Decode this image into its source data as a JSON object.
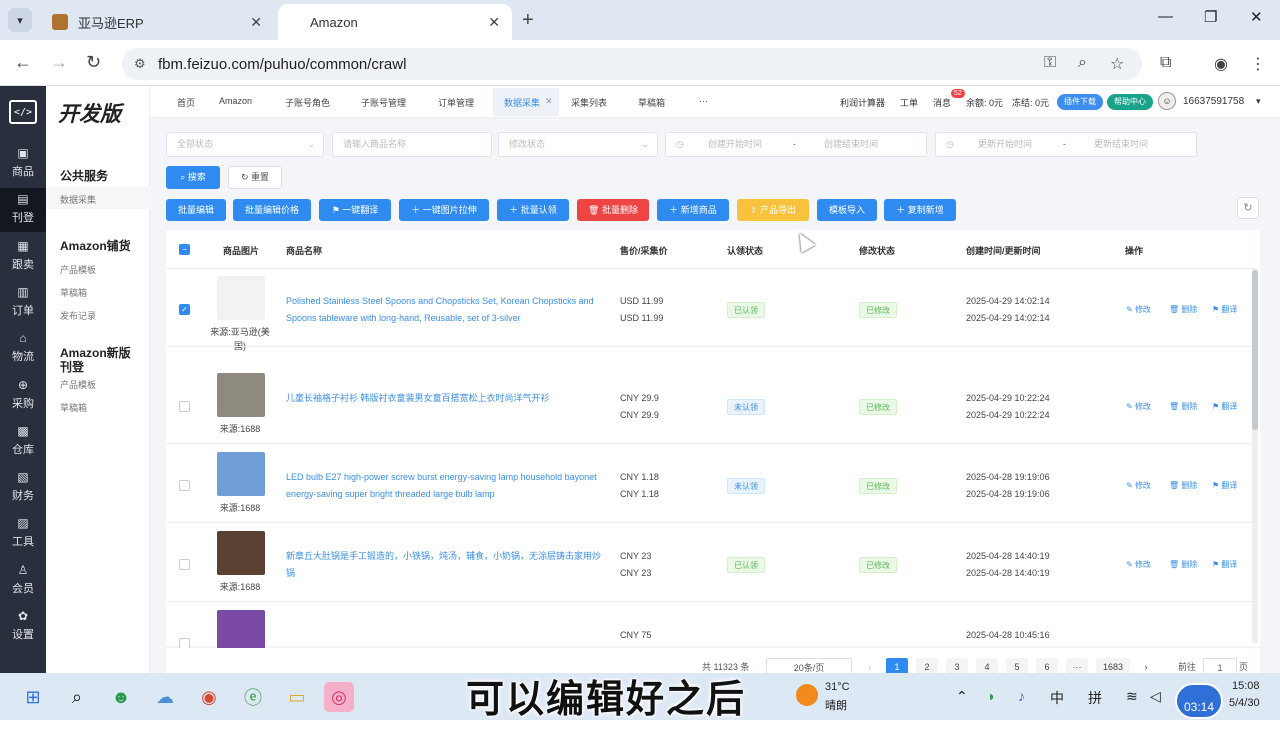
{
  "browser": {
    "tabs": [
      {
        "title": "亚马逊ERP",
        "favicon": "box-icon"
      },
      {
        "title": "Amazon",
        "favicon": ""
      }
    ],
    "new_tab_icon": "+",
    "window_controls": [
      "—",
      "❐",
      "✕"
    ],
    "url": "fbm.feizuo.com/puhuo/common/crawl"
  },
  "app": {
    "brand": "开发版",
    "left_nav": [
      {
        "icon": "shopping-bag-icon",
        "glyph": "▣",
        "label": "商品"
      },
      {
        "icon": "publish-icon",
        "glyph": "▤",
        "label": "刊登"
      },
      {
        "icon": "track-icon",
        "glyph": "▦",
        "label": "跟卖"
      },
      {
        "icon": "order-icon",
        "glyph": "▥",
        "label": "订单"
      },
      {
        "icon": "house-icon",
        "glyph": "⌂",
        "label": "物流"
      },
      {
        "icon": "cart-icon",
        "glyph": "⊕",
        "label": "采购"
      },
      {
        "icon": "warehouse-icon",
        "glyph": "▩",
        "label": "仓库"
      },
      {
        "icon": "finance-icon",
        "glyph": "▧",
        "label": "财务"
      },
      {
        "icon": "tool-icon",
        "glyph": "▨",
        "label": "工具"
      },
      {
        "icon": "user-icon",
        "glyph": "♙",
        "label": "会员"
      },
      {
        "icon": "gear-icon",
        "glyph": "✿",
        "label": "设置"
      }
    ],
    "sub_nav": {
      "groups": [
        {
          "title": "公共服务",
          "items": [
            "数据采集"
          ]
        },
        {
          "title": "Amazon铺货",
          "items": [
            "产品模板",
            "草稿箱",
            "发布记录"
          ]
        },
        {
          "title": "Amazon新版刊登",
          "items": [
            "产品模板",
            "草稿箱"
          ]
        }
      ]
    },
    "top_tabs": [
      "首页",
      "Amazon",
      "子账号角色",
      "子账号管理",
      "订单管理",
      "数据采集",
      "采集列表",
      "草稿箱",
      "···"
    ],
    "top_right": {
      "calc": "利润计算器",
      "ticket": "工单",
      "msg": "消息",
      "msg_count": "52",
      "balance": "余额: 0元",
      "frozen": "冻结: 0元",
      "plugin": "插件下载",
      "help": "帮助中心",
      "phone": "16637591758"
    }
  },
  "filters": {
    "status_all": "全部状态",
    "name_placeholder": "请输入商品名称",
    "modify_status": "修改状态",
    "create_start": "创建开始时间",
    "create_end": "创建结束时间",
    "update_start": "更新开始时间",
    "update_end": "更新结束时间",
    "dash": "-",
    "search": "搜索",
    "reset": "重置"
  },
  "actions": [
    "批量编辑",
    "批量编辑价格",
    "一键翻译",
    "一键图片拉伸",
    "批量认领",
    "批量删除",
    "新增商品",
    "产品导出",
    "模板导入",
    "复制新增"
  ],
  "table": {
    "headers": [
      "商品图片",
      "商品名称",
      "售价/采集价",
      "认领状态",
      "修改状态",
      "创建时间/更新时间",
      "操作"
    ],
    "ops": [
      "修改",
      "删除",
      "翻译"
    ],
    "rows": [
      {
        "checked": true,
        "source": "来源:亚马逊(美国)",
        "name": "Polished Stainless Steel Spoons and Chopsticks Set, Korean Chopsticks and Spoons tableware with long-hand, Reusable, set of 3-silver",
        "price1": "USD 11.99",
        "price2": "USD 11.99",
        "claim": "已认领",
        "claim_color": "green",
        "modify": "已修改",
        "t1": "2025-04-29 14:02:14",
        "t2": "2025-04-29 14:02:14",
        "img": "#f2f2f2"
      },
      {
        "checked": false,
        "source": "来源:1688",
        "name": "儿童长袖格子衬衫 韩版衬衣童装男女童百搭宽松上衣时尚洋气开衫",
        "price1": "CNY 29.9",
        "price2": "CNY 29.9",
        "claim": "未认领",
        "claim_color": "blue",
        "modify": "已修改",
        "t1": "2025-04-29 10:22:24",
        "t2": "2025-04-29 10:22:24",
        "img": "#8e8a80"
      },
      {
        "checked": false,
        "source": "来源:1688",
        "name": "LED bulb E27 high-power screw burst energy-saving lamp household bayonet energy-saving super bright threaded large bulb lamp",
        "price1": "CNY 1.18",
        "price2": "CNY 1.18",
        "claim": "未认领",
        "claim_color": "blue",
        "modify": "已修改",
        "t1": "2025-04-28 19:19:06",
        "t2": "2025-04-28 19:19:06",
        "img": "#6f9fd6"
      },
      {
        "checked": false,
        "source": "来源:1688",
        "name": "新章丘大肚锅是手工锻造的，小铁锅，炖汤，辅食，小奶锅，无涂层铸击家用炒锅",
        "price1": "CNY 23",
        "price2": "CNY 23",
        "claim": "已认领",
        "claim_color": "green",
        "modify": "已修改",
        "t1": "2025-04-28 14:40:19",
        "t2": "2025-04-28 14:40:19",
        "img": "#5a4030"
      },
      {
        "checked": false,
        "source": "",
        "name": "",
        "price1": "CNY 75",
        "price2": "",
        "claim": "",
        "claim_color": "blue",
        "modify": "",
        "t1": "2025-04-28 10:45:16",
        "t2": "",
        "img": "#7b4aa6"
      }
    ]
  },
  "pagination": {
    "total": "共 11323 条",
    "per_page": "20条/页",
    "pages": [
      "1",
      "2",
      "3",
      "4",
      "5",
      "6",
      "···",
      "1683"
    ],
    "goto_label": "前往",
    "goto_value": "1",
    "page_unit": "页"
  },
  "taskbar": {
    "subtitle": "可以编辑好之后",
    "weather_temp": "31°C",
    "weather_desc": "晴朗",
    "ime1": "中",
    "ime2": "拼",
    "time": "15:08",
    "date": "5/4/30",
    "video_time": "03:14"
  }
}
